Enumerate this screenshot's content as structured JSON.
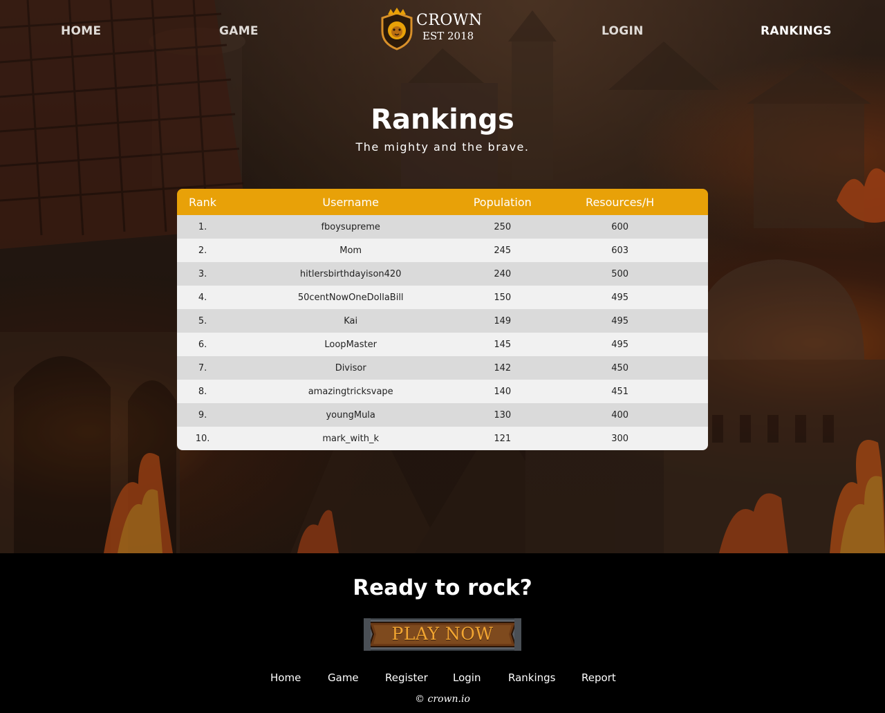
{
  "nav": {
    "home": "HOME",
    "game": "GAME",
    "login": "LOGIN",
    "rankings": "RANKINGS"
  },
  "logo": {
    "name": "CROWN",
    "est": "EST 2018"
  },
  "header": {
    "title": "Rankings",
    "subtitle": "The mighty and the brave."
  },
  "table": {
    "columns": [
      "Rank",
      "Username",
      "Population",
      "Resources/H"
    ],
    "rows": [
      {
        "rank": "1.",
        "username": "fboysupreme",
        "population": "250",
        "resources": "600"
      },
      {
        "rank": "2.",
        "username": "Mom",
        "population": "245",
        "resources": "603"
      },
      {
        "rank": "3.",
        "username": "hitlersbirthdayison420",
        "population": "240",
        "resources": "500"
      },
      {
        "rank": "4.",
        "username": "50centNowOneDollaBill",
        "population": "150",
        "resources": "495"
      },
      {
        "rank": "5.",
        "username": "Kai",
        "population": "149",
        "resources": "495"
      },
      {
        "rank": "6.",
        "username": "LoopMaster",
        "population": "145",
        "resources": "495"
      },
      {
        "rank": "7.",
        "username": "Divisor",
        "population": "142",
        "resources": "450"
      },
      {
        "rank": "8.",
        "username": "amazingtricksvape",
        "population": "140",
        "resources": "451"
      },
      {
        "rank": "9.",
        "username": "youngMula",
        "population": "130",
        "resources": "400"
      },
      {
        "rank": "10.",
        "username": "mark_with_k",
        "population": "121",
        "resources": "300"
      }
    ]
  },
  "footer": {
    "cta": "Ready to rock?",
    "play_button": "PLAY NOW",
    "links": {
      "home": "Home",
      "game": "Game",
      "register": "Register",
      "login": "Login",
      "rankings": "Rankings",
      "report": "Report"
    },
    "copyright": "© crown.io"
  },
  "colors": {
    "accent": "#e8a108",
    "row_odd": "#dadada",
    "row_even": "#f1f1f1",
    "footer_bg": "#000000",
    "play_text": "#f2a531"
  }
}
